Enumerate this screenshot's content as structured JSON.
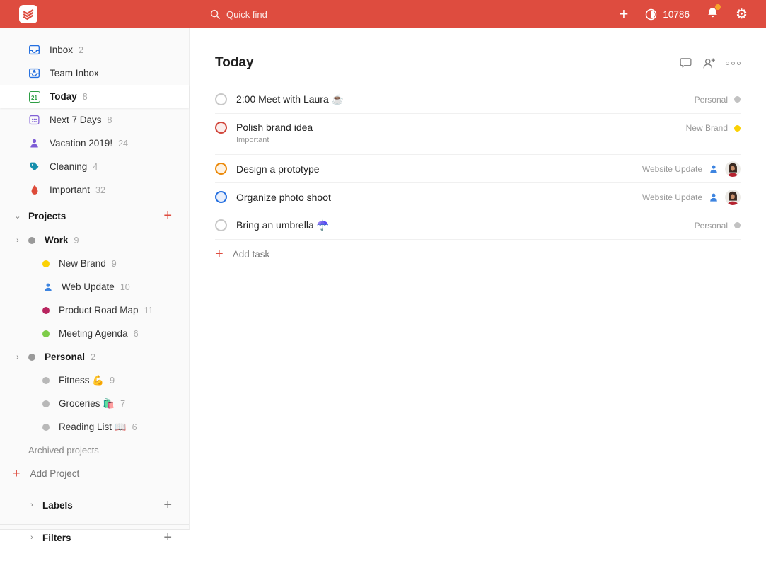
{
  "topbar": {
    "search_placeholder": "Quick find",
    "karma_count": "10786"
  },
  "colors": {
    "brand_red": "#de4c3f",
    "badge_orange": "#f7a32b",
    "inbox_blue": "#246fe0",
    "today_green": "#2e9e44",
    "next7_purple": "#8160d6",
    "vacation_purple": "#7d5bd6",
    "cleaning_teal": "#158fad",
    "important_red": "#dd4b39",
    "new_brand_yellow": "#fbd104",
    "web_update_blue": "#3d84e0",
    "product_roadmap_berry": "#b8255f",
    "meeting_agenda_green": "#7ecc49",
    "priority1_red": "#d1453b",
    "priority2_orange": "#eb8909",
    "priority3_blue": "#246fe0"
  },
  "sidebar": {
    "items": [
      {
        "icon": "inbox-icon",
        "label": "Inbox",
        "count": "2"
      },
      {
        "icon": "team-inbox-icon",
        "label": "Team Inbox",
        "count": ""
      },
      {
        "icon": "today-calendar-icon",
        "icon_text": "21",
        "label": "Today",
        "count": "8"
      },
      {
        "icon": "next-7-days-icon",
        "label": "Next 7 Days",
        "count": "8"
      },
      {
        "icon": "person-icon",
        "label": "Vacation 2019!",
        "count": "24"
      },
      {
        "icon": "tag-icon",
        "label": "Cleaning",
        "count": "4"
      },
      {
        "icon": "flame-icon",
        "label": "Important",
        "count": "32"
      }
    ],
    "projects_header": {
      "label": "Projects"
    },
    "work": {
      "label": "Work",
      "count": "9"
    },
    "work_children": [
      {
        "label": "New Brand",
        "count": "9"
      },
      {
        "label": "Web Update",
        "count": "10"
      },
      {
        "label": "Product Road Map",
        "count": "11"
      },
      {
        "label": "Meeting Agenda",
        "count": "6"
      }
    ],
    "personal": {
      "label": "Personal",
      "count": "2"
    },
    "personal_children": [
      {
        "label": "Fitness 💪",
        "count": "9"
      },
      {
        "label": "Groceries 🛍️",
        "count": "7"
      },
      {
        "label": "Reading List 📖",
        "count": "6"
      }
    ],
    "archived_label": "Archived projects",
    "add_project_label": "Add Project",
    "labels_header": "Labels",
    "filters_header": "Filters"
  },
  "main": {
    "title": "Today",
    "tasks": [
      {
        "title": "2:00 Meet with Laura ☕",
        "priority": "p4",
        "project": "Personal"
      },
      {
        "title": "Polish brand idea",
        "sublabel": "Important",
        "priority": "p1",
        "project": "New Brand"
      },
      {
        "title": "Design a prototype",
        "priority": "p2",
        "project": "Website Update"
      },
      {
        "title": "Organize photo shoot",
        "priority": "p3",
        "project": "Website Update"
      },
      {
        "title": "Bring an umbrella ☂️",
        "priority": "p4",
        "project": "Personal"
      }
    ],
    "add_task_label": "Add task"
  }
}
